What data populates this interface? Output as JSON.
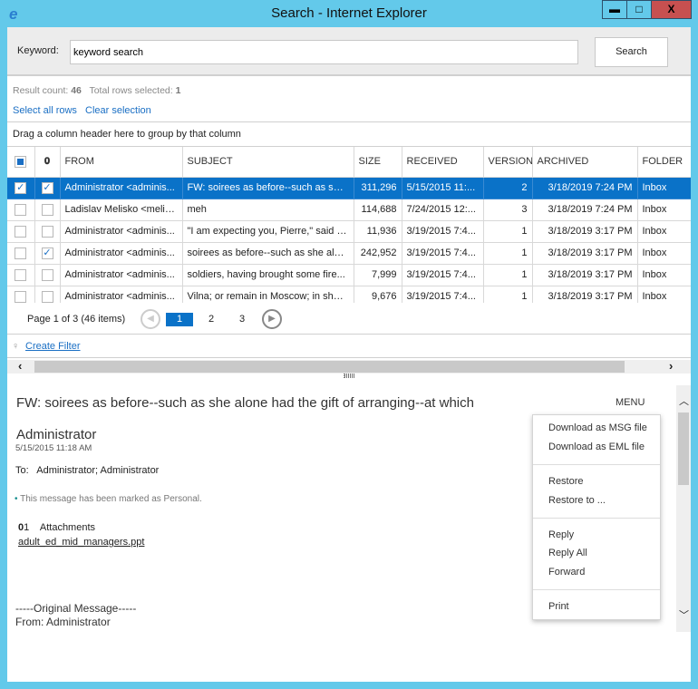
{
  "window": {
    "title": "Search - Internet Explorer",
    "minimize": "▬",
    "maximize": "□",
    "close": "X"
  },
  "search": {
    "label": "Keyword:",
    "value": "keyword search",
    "button": "Search"
  },
  "stats": {
    "result_count_label": "Result count:",
    "result_count": "46",
    "selected_label": "Total rows selected:",
    "selected": "1"
  },
  "actions": {
    "select_all": "Select all rows",
    "clear": "Clear selection"
  },
  "group_hint": "Drag a column header here to group by that column",
  "columns": [
    "FROM",
    "SUBJECT",
    "SIZE",
    "RECEIVED",
    "VERSION",
    "ARCHIVED",
    "FOLDER"
  ],
  "rows": [
    {
      "from": "Administrator <adminis...",
      "subject": "FW: soirees as before--such as she...",
      "size": "311,296",
      "received": "5/15/2015 11:...",
      "version": "2",
      "archived": "3/18/2019 7:24 PM",
      "folder": "Inbox",
      "selected": true,
      "attach": true
    },
    {
      "from": "Ladislav Melisko <melis...",
      "subject": "meh",
      "size": "114,688",
      "received": "7/24/2015 12:...",
      "version": "3",
      "archived": "3/18/2019 7:24 PM",
      "folder": "Inbox",
      "selected": false,
      "attach": false
    },
    {
      "from": "Administrator <adminis...",
      "subject": "\"I am expecting you, Pierre,\" said th...",
      "size": "11,936",
      "received": "3/19/2015 7:4...",
      "version": "1",
      "archived": "3/18/2019 3:17 PM",
      "folder": "Inbox",
      "selected": false,
      "attach": false
    },
    {
      "from": "Administrator <adminis...",
      "subject": "soirees as before--such as she alon...",
      "size": "242,952",
      "received": "3/19/2015 7:4...",
      "version": "1",
      "archived": "3/18/2019 3:17 PM",
      "folder": "Inbox",
      "selected": false,
      "attach": true
    },
    {
      "from": "Administrator <adminis...",
      "subject": "soldiers, having brought some fire...",
      "size": "7,999",
      "received": "3/19/2015 7:4...",
      "version": "1",
      "archived": "3/18/2019 3:17 PM",
      "folder": "Inbox",
      "selected": false,
      "attach": false
    },
    {
      "from": "Administrator <adminis...",
      "subject": "Vilna; or remain in Moscow; in shor...",
      "size": "9,676",
      "received": "3/19/2015 7:4...",
      "version": "1",
      "archived": "3/18/2019 3:17 PM",
      "folder": "Inbox",
      "selected": false,
      "attach": false
    }
  ],
  "pager": {
    "summary": "Page 1 of 3 (46 items)",
    "pages": [
      "1",
      "2",
      "3"
    ],
    "current": "1"
  },
  "filter": {
    "label": "Create Filter"
  },
  "preview": {
    "subject": "FW: soirees as before--such as she alone had the gift of arranging--at which",
    "menu_label": "MENU",
    "sender": "Administrator",
    "date": "5/15/2015 11:18 AM",
    "to_label": "To:",
    "to": "Administrator; Administrator",
    "notice": "This message has been marked as Personal.",
    "attach_count": "1",
    "attach_label": "Attachments",
    "attachment": "adult_ed_mid_managers.ppt",
    "original": "-----Original Message-----",
    "from_line": "From: Administrator"
  },
  "menu": {
    "items": [
      "Download as MSG file",
      "Download as EML file",
      "Restore",
      "Restore to ...",
      "Reply",
      "Reply All",
      "Forward",
      "Print"
    ]
  },
  "colors": {
    "accent": "#0a72c8",
    "frame": "#63c9ea",
    "close": "#c75050"
  }
}
